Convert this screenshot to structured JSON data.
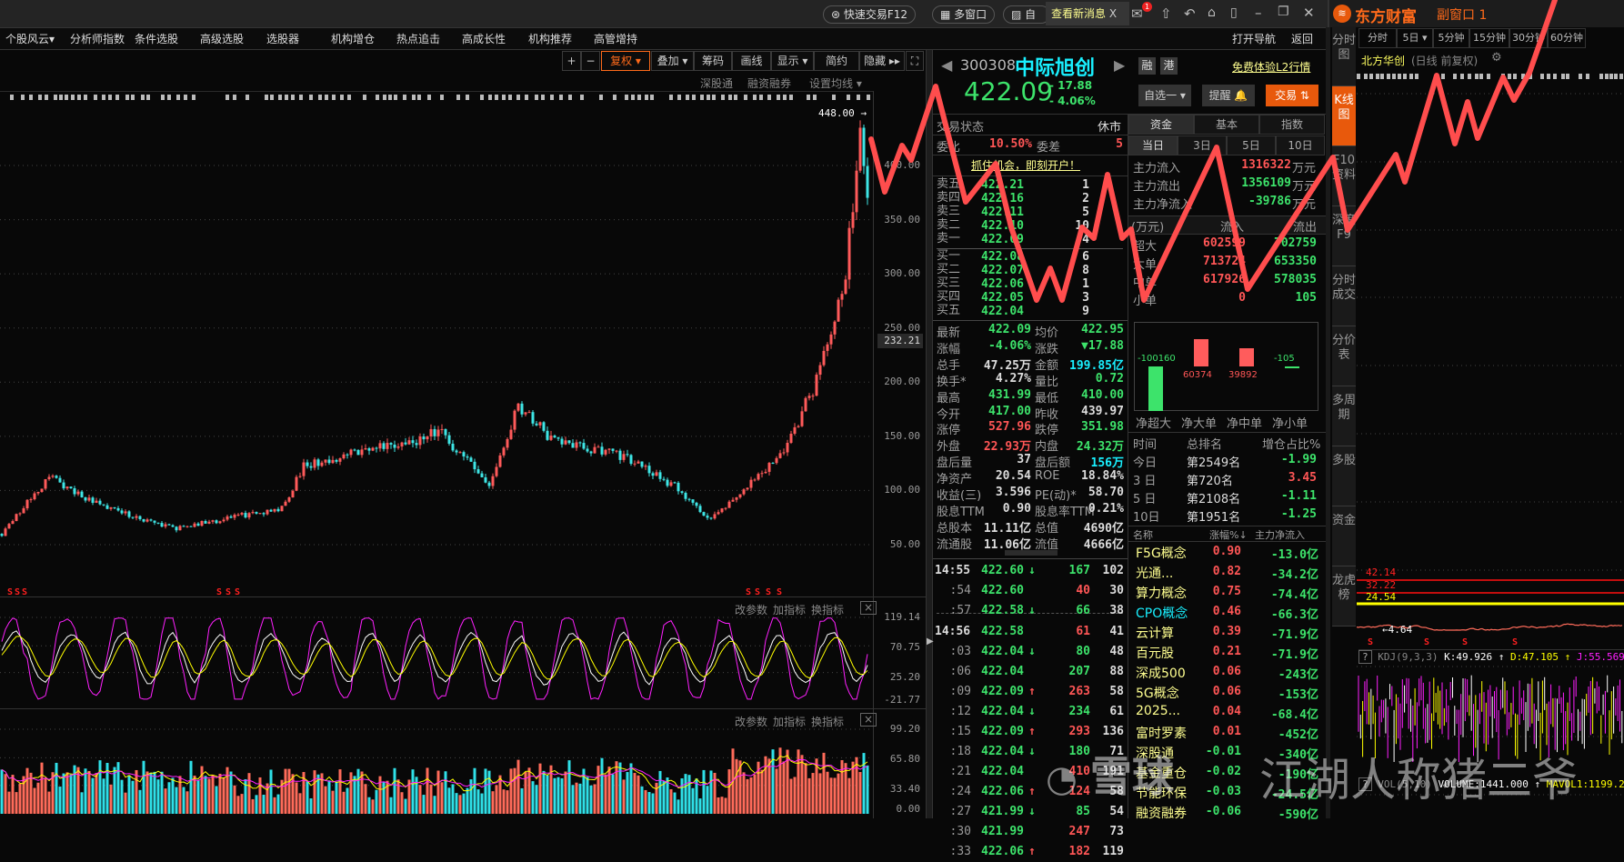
{
  "title_bar": {
    "quick_trade": "快速交易F12",
    "multi_window": "多窗口",
    "watchlist": "自选",
    "news": "查看新消息",
    "news_close": "X",
    "mail_badge": "1"
  },
  "nav": {
    "items": [
      "个股风云▾",
      "分析师指数",
      "条件选股",
      "高级选股",
      "选股器",
      "机构增仓",
      "热点追击",
      "高成长性",
      "机构推荐",
      "高管增持"
    ],
    "open_nav": "打开导航",
    "back": "返回"
  },
  "chart_toolbar": {
    "zoom_in": "+",
    "zoom_out": "−",
    "adjust": "复权 ▾",
    "overlay": "叠加 ▾",
    "chips": "筹码",
    "draw": "画线",
    "display": "显示 ▾",
    "simple": "简约",
    "hide": "隐藏 ▸▸",
    "fullscreen": "⛶"
  },
  "chart_subbar": {
    "hk_connect": "深股通",
    "margin": "融资融券",
    "ma_settings": "设置均线 ▾"
  },
  "main_chart": {
    "high_label": "448.00 →",
    "y_ticks": [
      "400.00",
      "350.00",
      "300.00",
      "250.00",
      "200.00",
      "150.00",
      "100.00",
      "50.00"
    ],
    "current_label": "232.21",
    "marker": "S"
  },
  "kdj_panel": {
    "buttons": [
      "改参数",
      "加指标",
      "换指标"
    ],
    "close": "×",
    "y_ticks": [
      "119.14",
      "70.75",
      "25.20",
      "-21.77"
    ]
  },
  "vol_panel": {
    "buttons": [
      "改参数",
      "加指标",
      "换指标"
    ],
    "close": "×",
    "y_ticks": [
      "99.20",
      "65.80",
      "33.40",
      "0.00"
    ]
  },
  "quote": {
    "code": "300308",
    "name": "中际旭创",
    "price": "422.09",
    "change": "- 17.88",
    "change_pct": "- 4.06%",
    "tags": [
      "融",
      "港"
    ],
    "l2_link": "免费体验L2行情",
    "watch_btn": "自选一 ▾",
    "alert_btn": "提醒 🔔",
    "trade_btn": "交易 ⇅",
    "status_label": "交易状态",
    "status": "休市",
    "ratio_label": "委比",
    "ratio": "10.50%",
    "diff_label": "委差",
    "diff": "5",
    "promo": "抓住机会，即刻开户！",
    "asks": [
      {
        "label": "卖五",
        "price": "422.21",
        "vol": "1"
      },
      {
        "label": "卖四",
        "price": "422.16",
        "vol": "2"
      },
      {
        "label": "卖三",
        "price": "422.11",
        "vol": "5"
      },
      {
        "label": "卖二",
        "price": "422.10",
        "vol": "10"
      },
      {
        "label": "卖一",
        "price": "422.09",
        "vol": "4"
      }
    ],
    "bids": [
      {
        "label": "买一",
        "price": "422.08",
        "vol": "6"
      },
      {
        "label": "买二",
        "price": "422.07",
        "vol": "8"
      },
      {
        "label": "买三",
        "price": "422.06",
        "vol": "1"
      },
      {
        "label": "买四",
        "price": "422.05",
        "vol": "3"
      },
      {
        "label": "买五",
        "price": "422.04",
        "vol": "9"
      }
    ],
    "stats": [
      {
        "l1": "最新",
        "v1": "422.09",
        "c1": "g",
        "l2": "均价",
        "v2": "422.95",
        "c2": "g"
      },
      {
        "l1": "涨幅",
        "v1": "-4.06%",
        "c1": "g",
        "l2": "涨跌",
        "v2": "▼17.88",
        "c2": "g"
      },
      {
        "l1": "总手",
        "v1": "47.25万",
        "c1": "w",
        "l2": "金额",
        "v2": "199.85亿",
        "c2": "c"
      },
      {
        "l1": "换手*",
        "v1": "4.27%",
        "c1": "w",
        "l2": "量比",
        "v2": "0.72",
        "c2": "g"
      },
      {
        "l1": "最高",
        "v1": "431.99",
        "c1": "g",
        "l2": "最低",
        "v2": "410.00",
        "c2": "g"
      },
      {
        "l1": "今开",
        "v1": "417.00",
        "c1": "g",
        "l2": "昨收",
        "v2": "439.97",
        "c2": "w"
      },
      {
        "l1": "涨停",
        "v1": "527.96",
        "c1": "r",
        "l2": "跌停",
        "v2": "351.98",
        "c2": "g"
      },
      {
        "l1": "外盘",
        "v1": "22.93万",
        "c1": "r",
        "l2": "内盘",
        "v2": "24.32万",
        "c2": "g"
      },
      {
        "l1": "盘后量",
        "v1": "37",
        "c1": "w",
        "l2": "盘后额",
        "v2": "156万",
        "c2": "c"
      },
      {
        "l1": "净资产",
        "v1": "20.54",
        "c1": "w",
        "l2": "ROE",
        "v2": "18.84%",
        "c2": "w"
      },
      {
        "l1": "收益(三)",
        "v1": "3.596",
        "c1": "w",
        "l2": "PE(动)*",
        "v2": "58.70",
        "c2": "w"
      },
      {
        "l1": "股息TTM",
        "v1": "0.90",
        "c1": "w",
        "l2": "股息率TTM",
        "v2": "0.21%",
        "c2": "w"
      },
      {
        "l1": "总股本",
        "v1": "11.11亿",
        "c1": "w",
        "l2": "总值",
        "v2": "4690亿",
        "c2": "w"
      },
      {
        "l1": "流通股",
        "v1": "11.06亿",
        "c1": "w",
        "l2": "流值",
        "v2": "4666亿",
        "c2": "w"
      }
    ],
    "trades": [
      {
        "time": "14:55",
        "price": "422.60",
        "dir": "↓",
        "vol": "167",
        "vc": "g",
        "count": "102",
        "major": true
      },
      {
        "time": ":54",
        "price": "422.60",
        "dir": "",
        "vol": "40",
        "vc": "r",
        "count": "30"
      },
      {
        "time": ":57",
        "price": "422.58",
        "dir": "↓",
        "vol": "66",
        "vc": "g",
        "count": "38"
      },
      {
        "time": "14:56",
        "price": "422.58",
        "dir": "",
        "vol": "61",
        "vc": "r",
        "count": "41",
        "major": true
      },
      {
        "time": ":03",
        "price": "422.04",
        "dir": "↓",
        "vol": "80",
        "vc": "g",
        "count": "48"
      },
      {
        "time": ":06",
        "price": "422.04",
        "dir": "",
        "vol": "207",
        "vc": "g",
        "count": "88"
      },
      {
        "time": ":09",
        "price": "422.09",
        "dir": "↑",
        "vol": "263",
        "vc": "r",
        "count": "58"
      },
      {
        "time": ":12",
        "price": "422.04",
        "dir": "↓",
        "vol": "234",
        "vc": "g",
        "count": "61"
      },
      {
        "time": ":15",
        "price": "422.09",
        "dir": "↑",
        "vol": "293",
        "vc": "r",
        "count": "136"
      },
      {
        "time": ":18",
        "price": "422.04",
        "dir": "↓",
        "vol": "180",
        "vc": "g",
        "count": "71"
      },
      {
        "time": ":21",
        "price": "422.04",
        "dir": "",
        "vol": "410",
        "vc": "r",
        "count": "191"
      },
      {
        "time": ":24",
        "price": "422.06",
        "dir": "↑",
        "vol": "124",
        "vc": "r",
        "count": "58"
      },
      {
        "time": ":27",
        "price": "421.99",
        "dir": "↓",
        "vol": "85",
        "vc": "g",
        "count": "54"
      },
      {
        "time": ":30",
        "price": "421.99",
        "dir": "",
        "vol": "247",
        "vc": "r",
        "count": "73"
      },
      {
        "time": ":33",
        "price": "422.06",
        "dir": "↑",
        "vol": "182",
        "vc": "r",
        "count": "119"
      }
    ]
  },
  "fund": {
    "tabs": [
      "资金",
      "基本",
      "指数"
    ],
    "periods": [
      "当日",
      "3日",
      "5日",
      "10日"
    ],
    "flows": [
      {
        "label": "主力流入",
        "value": "1316322",
        "unit": "万元",
        "c": "r"
      },
      {
        "label": "主力流出",
        "value": "1356109",
        "unit": "万元",
        "c": "g"
      },
      {
        "label": "主力净流入",
        "value": "-39786",
        "unit": "万元",
        "c": "g"
      }
    ],
    "table_header": [
      "(万元)",
      "流入",
      "流出"
    ],
    "table": [
      {
        "label": "超大",
        "in": "602599",
        "out": "702759"
      },
      {
        "label": "大单",
        "in": "713724",
        "out": "653350"
      },
      {
        "label": "中单",
        "in": "617926",
        "out": "578035"
      },
      {
        "label": "小单",
        "in": "0",
        "out": "105"
      }
    ],
    "net_bars": [
      {
        "label": "净超大",
        "value": -100160,
        "text": "-100160"
      },
      {
        "label": "净大单",
        "value": 60374,
        "text": "60374"
      },
      {
        "label": "净中单",
        "value": 39892,
        "text": "39892"
      },
      {
        "label": "净小单",
        "value": -105,
        "text": "-105"
      }
    ],
    "rank_header": [
      "时间",
      "总排名",
      "增仓占比%"
    ],
    "rank": [
      {
        "period": "今日",
        "rank": "第2549名",
        "pct": "-1.99",
        "c": "g"
      },
      {
        "period": "3 日",
        "rank": "第720名",
        "pct": "3.45",
        "c": "r"
      },
      {
        "period": "5 日",
        "rank": "第2108名",
        "pct": "-1.11",
        "c": "g"
      },
      {
        "period": "10日",
        "rank": "第1951名",
        "pct": "-1.25",
        "c": "g"
      }
    ]
  },
  "sectors": {
    "header": [
      "名称",
      "涨幅%↓",
      "主力净流入"
    ],
    "rows": [
      {
        "name": "F5G概念",
        "pct": "0.90",
        "flow": "-13.0亿"
      },
      {
        "name": "光通...",
        "pct": "0.82",
        "flow": "-34.2亿"
      },
      {
        "name": "算力概念",
        "pct": "0.75",
        "flow": "-74.4亿"
      },
      {
        "name": "CPO概念",
        "pct": "0.46",
        "flow": "-66.3亿",
        "hl": true
      },
      {
        "name": "云计算",
        "pct": "0.39",
        "flow": "-71.9亿"
      },
      {
        "name": "百元股",
        "pct": "0.21",
        "flow": "-71.9亿"
      },
      {
        "name": "深成500",
        "pct": "0.06",
        "flow": "-243亿"
      },
      {
        "name": "5G概念",
        "pct": "0.06",
        "flow": "-153亿"
      },
      {
        "name": "2025...",
        "pct": "0.04",
        "flow": "-68.4亿"
      },
      {
        "name": "富时罗素",
        "pct": "0.01",
        "flow": "-452亿"
      },
      {
        "name": "深股通",
        "pct": "-0.01",
        "flow": "-340亿"
      },
      {
        "name": "基金重仓",
        "pct": "-0.02",
        "flow": "-190亿"
      },
      {
        "name": "节能环保",
        "pct": "-0.03",
        "flow": "-24.5亿"
      },
      {
        "name": "融资融券",
        "pct": "-0.06",
        "flow": "-590亿"
      }
    ]
  },
  "sub_window": {
    "brand": "东方财富",
    "title": "副窗口 1",
    "periods": [
      "分时",
      "5日 ▾",
      "5分钟",
      "15分钟",
      "30分钟",
      "60分钟"
    ],
    "side_tabs": [
      "分时图",
      "K线图",
      "F10资料",
      "深度F9",
      "分时成交",
      "分价表",
      "多周期",
      "多股",
      "资金",
      "龙虎榜"
    ],
    "active_side_tab": 1,
    "stock_name": "北方华创",
    "chart_mode": "(日线 前复权)",
    "levels": [
      {
        "text": "42.14",
        "c": "#ff2020"
      },
      {
        "text": "32.22",
        "c": "#ff2020"
      },
      {
        "text": "24.54",
        "c": "#ffff00"
      }
    ],
    "low_label": "←4.64",
    "kdj": {
      "help": "?",
      "name": "KDJ(9,3,3)",
      "k": "K:49.926 ↑",
      "d": "D:47.105 ↑",
      "j": "J:55.569 ↑"
    },
    "vol": {
      "help": "?",
      "name": "VOL(5,10)",
      "volume": "VOLUME:1441.000 ↑",
      "mavol": "MAVOL1:1199.200 ↓"
    }
  },
  "watermark": {
    "logo_text": "雪球",
    "text": "江湖人称猪二爷"
  },
  "colors": {
    "up": "#ff5656",
    "down": "#3de36b",
    "cyan": "#19f0ff",
    "accent": "#e8590c",
    "annotation": "#ff4d4d"
  }
}
